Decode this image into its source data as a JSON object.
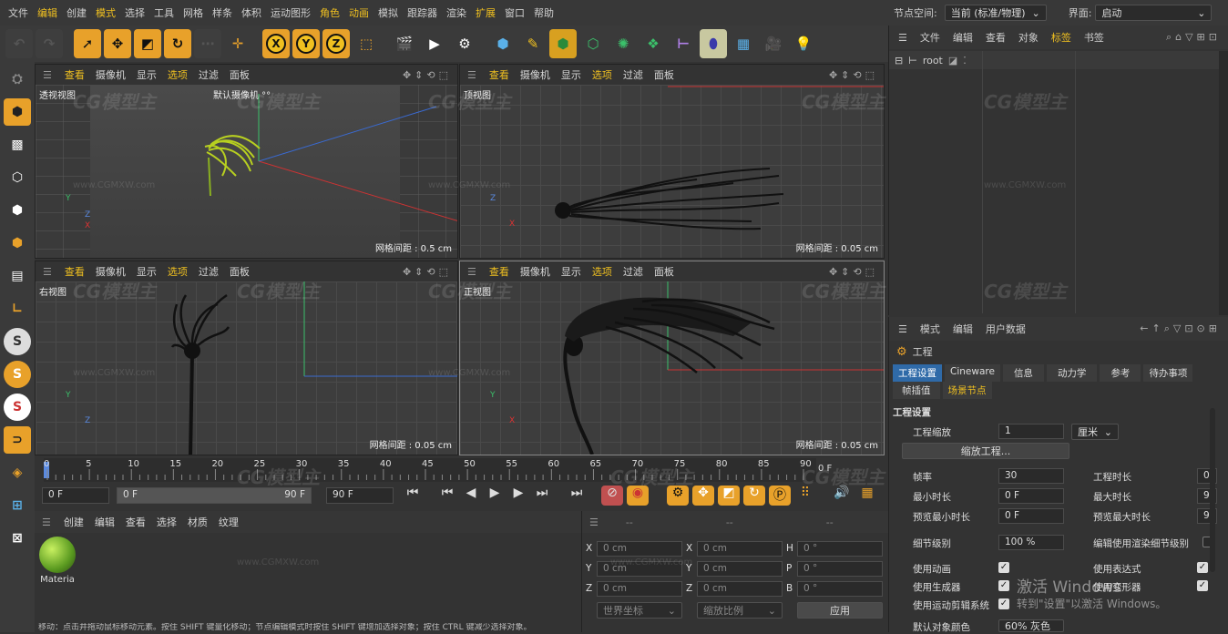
{
  "menu": [
    "文件",
    "编辑",
    "创建",
    "模式",
    "选择",
    "工具",
    "网格",
    "样条",
    "体积",
    "运动图形",
    "角色",
    "动画",
    "模拟",
    "跟踪器",
    "渲染",
    "扩展",
    "窗口",
    "帮助"
  ],
  "menu_highlight": [
    "编辑",
    "模式",
    "角色",
    "动画",
    "扩展"
  ],
  "top_right": {
    "node_space_label": "节点空间:",
    "node_space_value": "当前 (标准/物理)",
    "layout_label": "界面:",
    "layout_value": "启动"
  },
  "toolbar": {
    "x": "X",
    "y": "Y",
    "z": "Z"
  },
  "viewports": [
    {
      "menu": [
        "查看",
        "摄像机",
        "显示",
        "选项",
        "过滤",
        "面板"
      ],
      "title": "透视视图",
      "camera": "默认摄像机 °°",
      "grid": "网格间距 : 0.5 cm"
    },
    {
      "menu": [
        "查看",
        "摄像机",
        "显示",
        "选项",
        "过滤",
        "面板"
      ],
      "title": "顶视图",
      "grid": "网格间距 : 0.05 cm"
    },
    {
      "menu": [
        "查看",
        "摄像机",
        "显示",
        "选项",
        "过滤",
        "面板"
      ],
      "title": "右视图",
      "grid": "网格间距 : 0.05 cm"
    },
    {
      "menu": [
        "查看",
        "摄像机",
        "显示",
        "选项",
        "过滤",
        "面板"
      ],
      "title": "正视图",
      "grid": "网格间距 : 0.05 cm"
    }
  ],
  "axis": {
    "x": "X",
    "y": "Y",
    "z": "Z"
  },
  "object_manager": {
    "menu": [
      "文件",
      "编辑",
      "查看",
      "对象",
      "标签",
      "书签"
    ],
    "root": "root"
  },
  "attributes": {
    "menu": [
      "模式",
      "编辑",
      "用户数据"
    ],
    "object": "工程",
    "tabs": [
      "工程设置",
      "Cineware",
      "信息",
      "动力学",
      "参考",
      "待办事项"
    ],
    "tabs2": [
      "帧插值",
      "场景节点"
    ],
    "section": "工程设置",
    "scale_label": "工程缩放",
    "scale_value": "1",
    "scale_unit": "厘米",
    "scale_button": "缩放工程...",
    "fps_label": "帧率",
    "fps_value": "30",
    "project_time_label": "工程时长",
    "project_time_value": "0",
    "min_time_label": "最小时长",
    "min_time_value": "0 F",
    "max_time_label": "最大时长",
    "max_time_value": "9",
    "preview_min_label": "预览最小时长",
    "preview_min_value": "0 F",
    "preview_max_label": "预览最大时长",
    "preview_max_value": "9",
    "lod_label": "细节级别",
    "lod_value": "100 %",
    "render_lod_label": "编辑使用渲染细节级别",
    "use_anim": "使用动画",
    "use_expr": "使用表达式",
    "use_gen": "使用生成器",
    "use_deform": "使用变形器",
    "use_mograph": "使用运动剪辑系统",
    "default_color_label": "默认对象颜色",
    "default_color_value": "60% 灰色",
    "activate_line1": "激活 Windows",
    "activate_line2": "转到\"设置\"以激活 Windows。"
  },
  "timeline": {
    "ticks": [
      "0",
      "5",
      "10",
      "15",
      "20",
      "25",
      "30",
      "35",
      "40",
      "45",
      "50",
      "55",
      "60",
      "65",
      "70",
      "75",
      "80",
      "85",
      "90"
    ],
    "end_label": "0 F",
    "start_field": "0 F",
    "range_start": "0 F",
    "range_end": "90 F",
    "end_field": "90 F"
  },
  "materials": {
    "menu": [
      "创建",
      "编辑",
      "查看",
      "选择",
      "材质",
      "纹理"
    ],
    "item": "Materia"
  },
  "coords": {
    "x_label": "X",
    "x_pos": "0 cm",
    "x_size": "0 cm",
    "h_label": "H",
    "h_val": "0 °",
    "y_label": "Y",
    "y_pos": "0 cm",
    "y_size": "0 cm",
    "p_label": "P",
    "p_val": "0 °",
    "z_label": "Z",
    "z_pos": "0 cm",
    "z_size": "0 cm",
    "b_label": "B",
    "b_val": "0 °",
    "world": "世界坐标",
    "scale": "缩放比例",
    "apply": "应用",
    "col1": "--",
    "col2": "--",
    "col3": "--"
  },
  "statusbar": "移动：点击并拖动鼠标移动元素。按住 SHIFT 键量化移动；节点编辑模式时按住 SHIFT 键增加选择对象；按住 CTRL 键减少选择对象。",
  "watermark": "CG模型主",
  "watermark_url": "www.CGMXW.com",
  "colors": {
    "accent": "#e8a12a",
    "yellow": "#f0c020",
    "tab_active": "#2f6aa8"
  }
}
